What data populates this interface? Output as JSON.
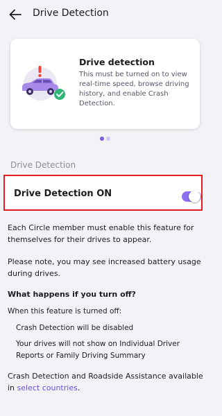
{
  "header": {
    "title": "Drive Detection",
    "back_icon": "arrow-left-icon"
  },
  "card": {
    "title": "Drive detection",
    "description": "This must be turned on to view real-time speed, browse driving history, and enable Crash Detection.",
    "illustration": "car-alert-check-illustration",
    "pager": {
      "total": 2,
      "active": 1
    }
  },
  "section_label": "Drive Detection",
  "toggle": {
    "label": "Drive Detection ON",
    "state": "on"
  },
  "paragraphs": {
    "enable_info": "Each Circle member must enable this feature for themselves for their drives to appear.",
    "battery_note": "Please note, you may see increased battery usage during drives."
  },
  "turn_off": {
    "heading": "What happens if you turn off?",
    "intro": "When this feature is turned off:",
    "items": [
      "Crash Detection will be disabled",
      "Your drives will not show on Individual Driver Reports or Family Driving Summary"
    ]
  },
  "footer": {
    "text": "Crash Detection and Roadside Assistance available in ",
    "link": "select countries",
    "end": "."
  },
  "colors": {
    "accent": "#7a5be6",
    "highlight_border": "#e61b22",
    "background": "#f3f2f6"
  }
}
